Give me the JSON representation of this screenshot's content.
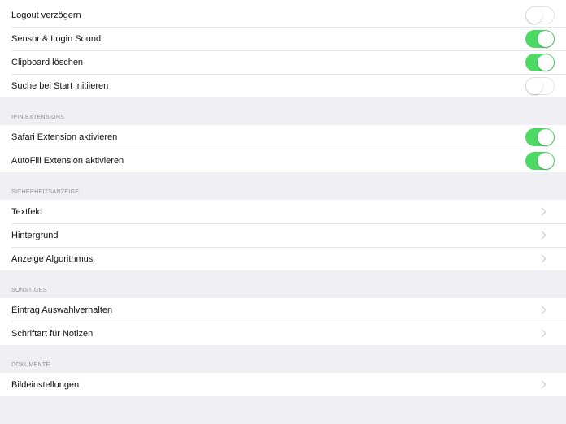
{
  "sections": {
    "general": {
      "rows": [
        {
          "label": "Logout verzögern",
          "toggle": "off"
        },
        {
          "label": "Sensor & Login Sound",
          "toggle": "on"
        },
        {
          "label": "Clipboard löschen",
          "toggle": "on"
        },
        {
          "label": "Suche bei Start initiieren",
          "toggle": "off"
        }
      ]
    },
    "extensions": {
      "header": "IPIN EXTENSIONS",
      "rows": [
        {
          "label": "Safari Extension aktivieren",
          "toggle": "on"
        },
        {
          "label": "AutoFill Extension aktivieren",
          "toggle": "on"
        }
      ]
    },
    "security_display": {
      "header": "SICHERHEITSANZEIGE",
      "rows": [
        {
          "label": "Textfeld"
        },
        {
          "label": "Hintergrund"
        },
        {
          "label": "Anzeige Algorithmus"
        }
      ]
    },
    "other": {
      "header": "SONSTIGES",
      "rows": [
        {
          "label": "Eintrag Auswahlverhalten"
        },
        {
          "label": "Schriftart für Notizen"
        }
      ]
    },
    "documents": {
      "header": "DOKUMENTE",
      "rows": [
        {
          "label": "Bildeinstellungen"
        }
      ]
    }
  },
  "colors": {
    "toggle_on": "#4cd964",
    "background": "#efeff4",
    "chevron": "#c7c7cc"
  },
  "icons": {
    "disclosure": "chevron-right-icon"
  }
}
